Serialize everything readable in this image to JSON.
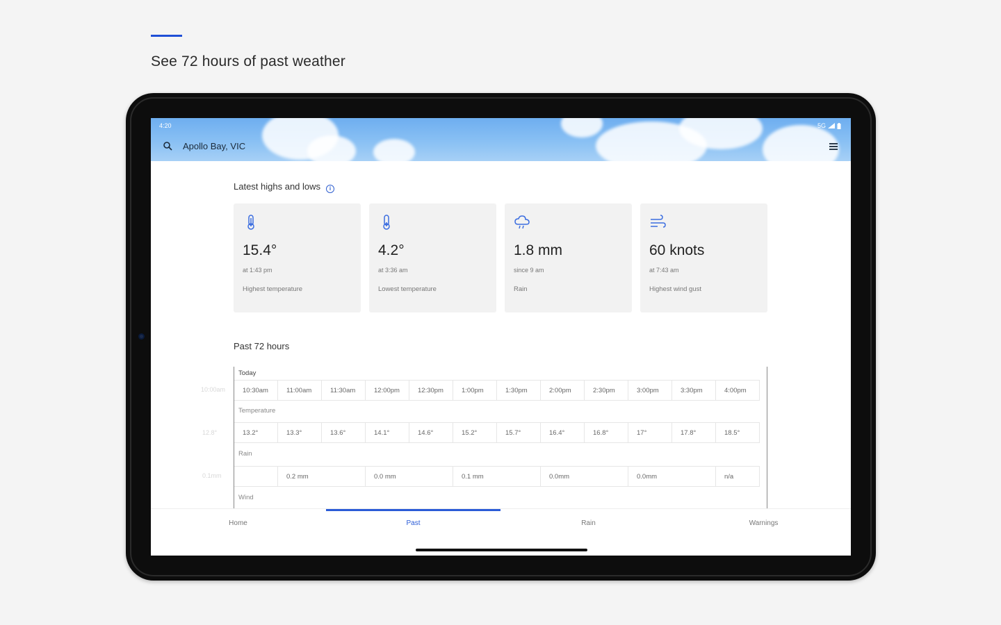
{
  "promo": {
    "headline": "See 72 hours of past weather",
    "accent_color": "#1f4fd6"
  },
  "status_bar": {
    "left": "4:20",
    "right": "5G"
  },
  "header": {
    "location": "Apollo Bay, VIC"
  },
  "highs_lows": {
    "title": "Latest highs and lows",
    "cards": [
      {
        "icon": "thermometer-high-icon",
        "value": "15.4°",
        "when": "at 1:43 pm",
        "label": "Highest temperature"
      },
      {
        "icon": "thermometer-low-icon",
        "value": "4.2°",
        "when": "at 3:36 am",
        "label": "Lowest temperature"
      },
      {
        "icon": "rain-cloud-icon",
        "value": "1.8 mm",
        "when": "since 9 am",
        "label": "Rain"
      },
      {
        "icon": "wind-icon",
        "value": "60 knots",
        "when": "at 7:43 am",
        "label": "Highest wind gust"
      }
    ]
  },
  "past72": {
    "title": "Past 72 hours",
    "day_label": "Today",
    "times": [
      "10:30am",
      "11:00am",
      "11:30am",
      "12:00pm",
      "12:30pm",
      "1:00pm",
      "1:30pm",
      "2:00pm",
      "2:30pm",
      "3:00pm",
      "3:30pm",
      "4:00pm"
    ],
    "temperature_label": "Temperature",
    "temperatures": [
      "13.2°",
      "13.3°",
      "13.6°",
      "14.1°",
      "14.6°",
      "15.2°",
      "15.7°",
      "16.4°",
      "16.8°",
      "17°",
      "17.8°",
      "18.5°"
    ],
    "rain_label": "Rain",
    "rain": [
      "",
      "0.2 mm",
      "0.0 mm",
      "0.1 mm",
      "0.0mm",
      "0.0mm",
      "n/a"
    ],
    "wind_label": "Wind",
    "offscreen": {
      "time": "10:00am",
      "temp": "12.8°",
      "rain": "0.1mm"
    }
  },
  "nav": {
    "items": [
      "Home",
      "Past",
      "Rain",
      "Warnings"
    ],
    "active_index": 1,
    "active_color": "#2a5bd7"
  }
}
